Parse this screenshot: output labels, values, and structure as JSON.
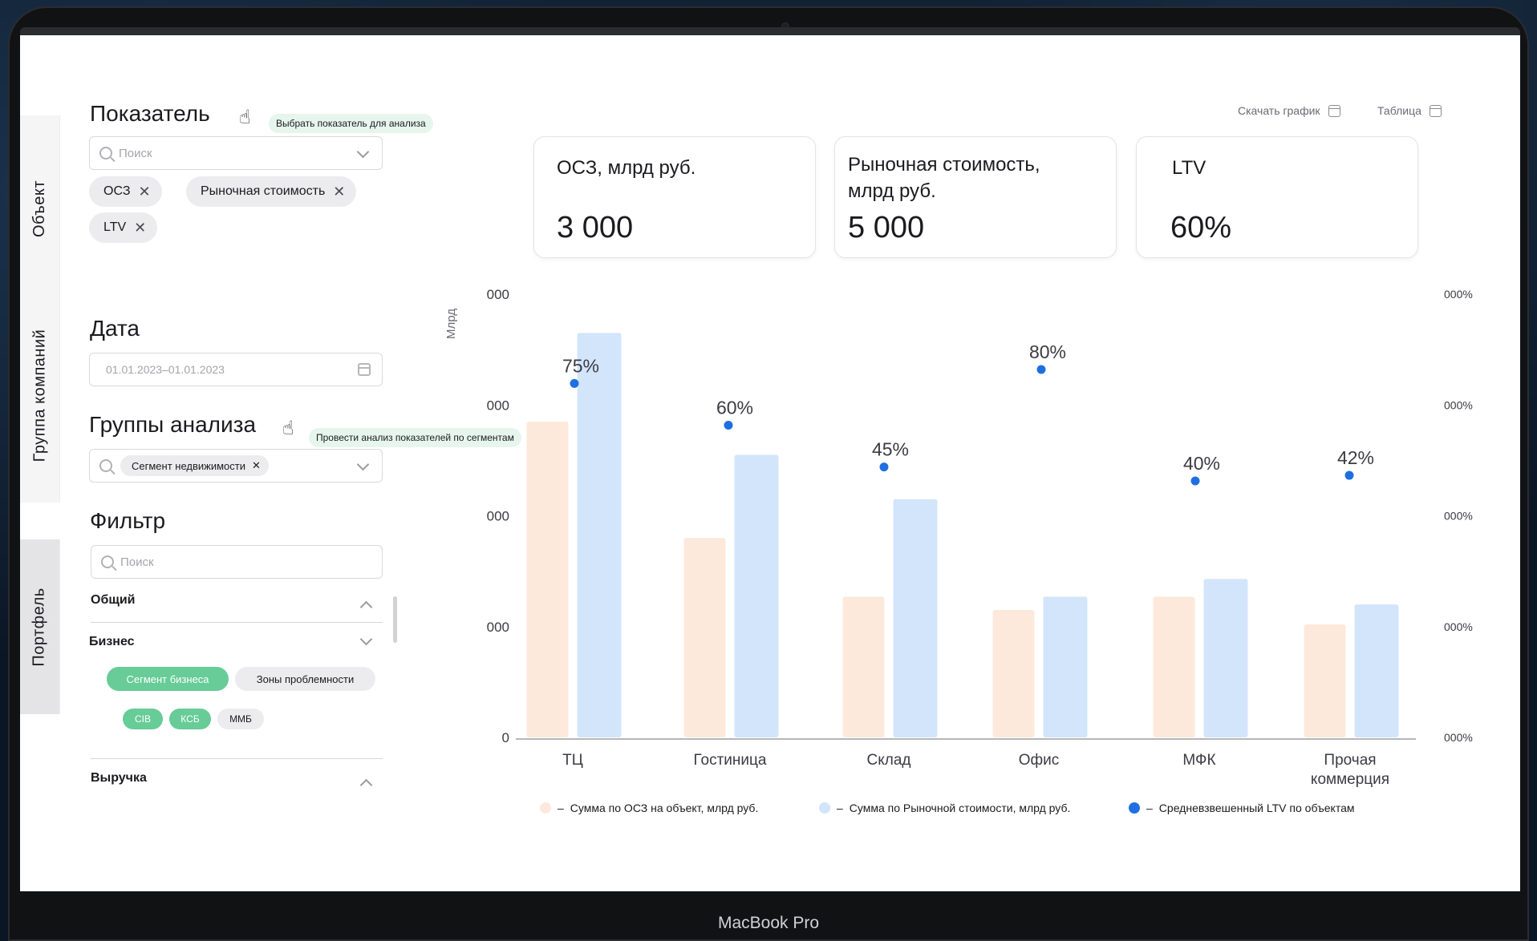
{
  "device": {
    "brand": "MacBook Pro"
  },
  "tabs": [
    "Объект",
    "Группа компаний",
    "Портфель"
  ],
  "indicator": {
    "title": "Показатель",
    "tooltip": "Выбрать показатель для анализа",
    "search_placeholder": "Поиск",
    "chips": [
      "ОСЗ",
      "Рыночная стоимость",
      "LTV"
    ]
  },
  "date": {
    "title": "Дата",
    "value": "01.01.2023–01.01.2023"
  },
  "groups": {
    "title": "Группы анализа",
    "tooltip": "Провести анализ показателей по сегментам",
    "chip": "Сегмент недвижимости"
  },
  "filter": {
    "title": "Фильтр",
    "search_placeholder": "Поиск",
    "sections": [
      "Общий",
      "Бизнес",
      "Выручка"
    ],
    "business_pills": [
      "Сегмент бизнеса",
      "Зоны проблемности"
    ],
    "segment_pills": [
      "CIB",
      "КСБ",
      "ММБ"
    ]
  },
  "actions": {
    "download": "Скачать график",
    "table": "Таблица"
  },
  "kpis": [
    {
      "label": "ОСЗ, млрд руб.",
      "value": "3 000"
    },
    {
      "label": "Рыночная стоимость, млрд руб.",
      "value": "5 000"
    },
    {
      "label": "LTV",
      "value": "60%"
    }
  ],
  "colors": {
    "osz": "#fde9dc",
    "market": "#d3e5fb",
    "ltv": "#1f6fe0",
    "accent": "#67cc97"
  },
  "chart_data": {
    "type": "bar",
    "categories": [
      "ТЦ",
      "Гостиница",
      "Склад",
      "Офис",
      "МФК",
      "Прочая коммерция"
    ],
    "category_lines": [
      [
        "ТЦ"
      ],
      [
        "Гостиница"
      ],
      [
        "Склад"
      ],
      [
        "Офис"
      ],
      [
        "МФК"
      ],
      [
        "Прочая",
        "коммерция"
      ]
    ],
    "ylabel": "Млрд",
    "y_ticks": [
      "000",
      "000",
      "000",
      "000",
      "0"
    ],
    "y2_ticks": [
      "000%",
      "000%",
      "000%",
      "000%",
      "000%"
    ],
    "y_range": [
      0,
      4
    ],
    "series": [
      {
        "name": "Сумма по ОСЗ на объект, млрд руб.",
        "kind": "bar",
        "values": [
          2.85,
          1.8,
          1.27,
          1.15,
          1.27,
          1.02
        ]
      },
      {
        "name": "Сумма по Рыночной стоимости, млрд руб.",
        "kind": "bar",
        "values": [
          3.65,
          2.55,
          2.15,
          1.27,
          1.43,
          1.2
        ]
      },
      {
        "name": "Средневзвешенный LTV по объектам",
        "kind": "point",
        "values": [
          75,
          60,
          45,
          80,
          40,
          42
        ],
        "labels": [
          "75%",
          "60%",
          "45%",
          "80%",
          "40%",
          "42%"
        ]
      }
    ]
  }
}
